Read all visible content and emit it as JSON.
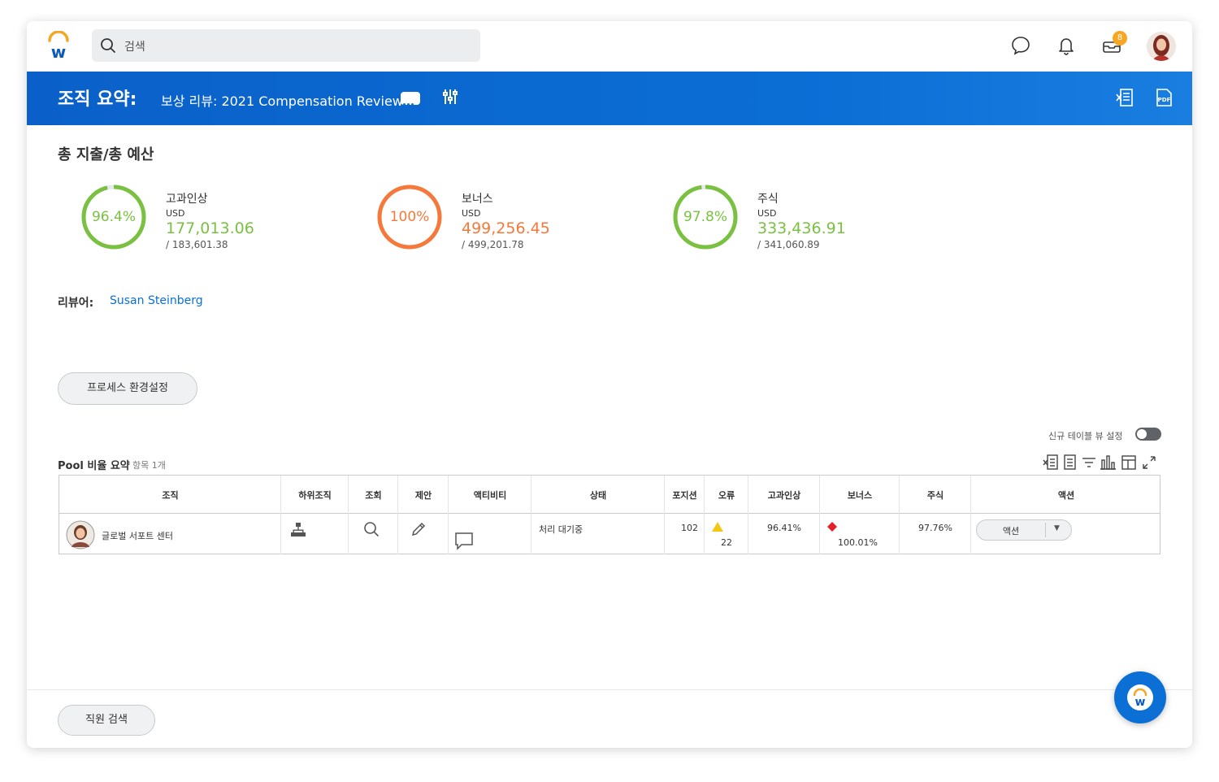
{
  "search": {
    "placeholder": "검색"
  },
  "topbar": {
    "inbox_badge": "8"
  },
  "banner": {
    "title": "조직 요약:",
    "subtitle": "보상 리뷰: 2021 Compensation Review"
  },
  "summary": {
    "title": "총 지출/총 예산",
    "kpis": [
      {
        "pct": "96.4%",
        "label": "고과인상",
        "currency": "USD",
        "amount": "177,013.06",
        "total": "/ 183,601.38",
        "fraction": 0.964,
        "color": "#7ac142"
      },
      {
        "pct": "100%",
        "label": "보너스",
        "currency": "USD",
        "amount": "499,256.45",
        "total": "/ 499,201.78",
        "fraction": 1.0,
        "color": "#f5793a"
      },
      {
        "pct": "97.8%",
        "label": "주식",
        "currency": "USD",
        "amount": "333,436.91",
        "total": "/ 341,060.89",
        "fraction": 0.978,
        "color": "#7ac142"
      }
    ]
  },
  "reviewer": {
    "label": "리뷰어:",
    "name": "Susan Steinberg"
  },
  "buttons": {
    "process_settings": "프로세스 환경설정",
    "employee_search": "직원 검색"
  },
  "table_view_toggle": "신규 테이블 뷰 설정",
  "grid": {
    "title": "Pool 비율 요약",
    "count": "항목 1개",
    "headers": [
      "조직",
      "하위조직",
      "조회",
      "제안",
      "액티비티",
      "상태",
      "포지션",
      "오류",
      "고과인상",
      "보너스",
      "주식",
      "액션"
    ],
    "row": {
      "org": "글로벌 서포트 센터",
      "status": "처리 대기중",
      "positions": "102",
      "errors": "22",
      "merit": "96.41%",
      "bonus": "100.01%",
      "stock": "97.76%",
      "action": "액션"
    }
  },
  "colors": {
    "brand_blue": "#0b6fd6",
    "green": "#7ac142",
    "orange": "#f5793a"
  }
}
